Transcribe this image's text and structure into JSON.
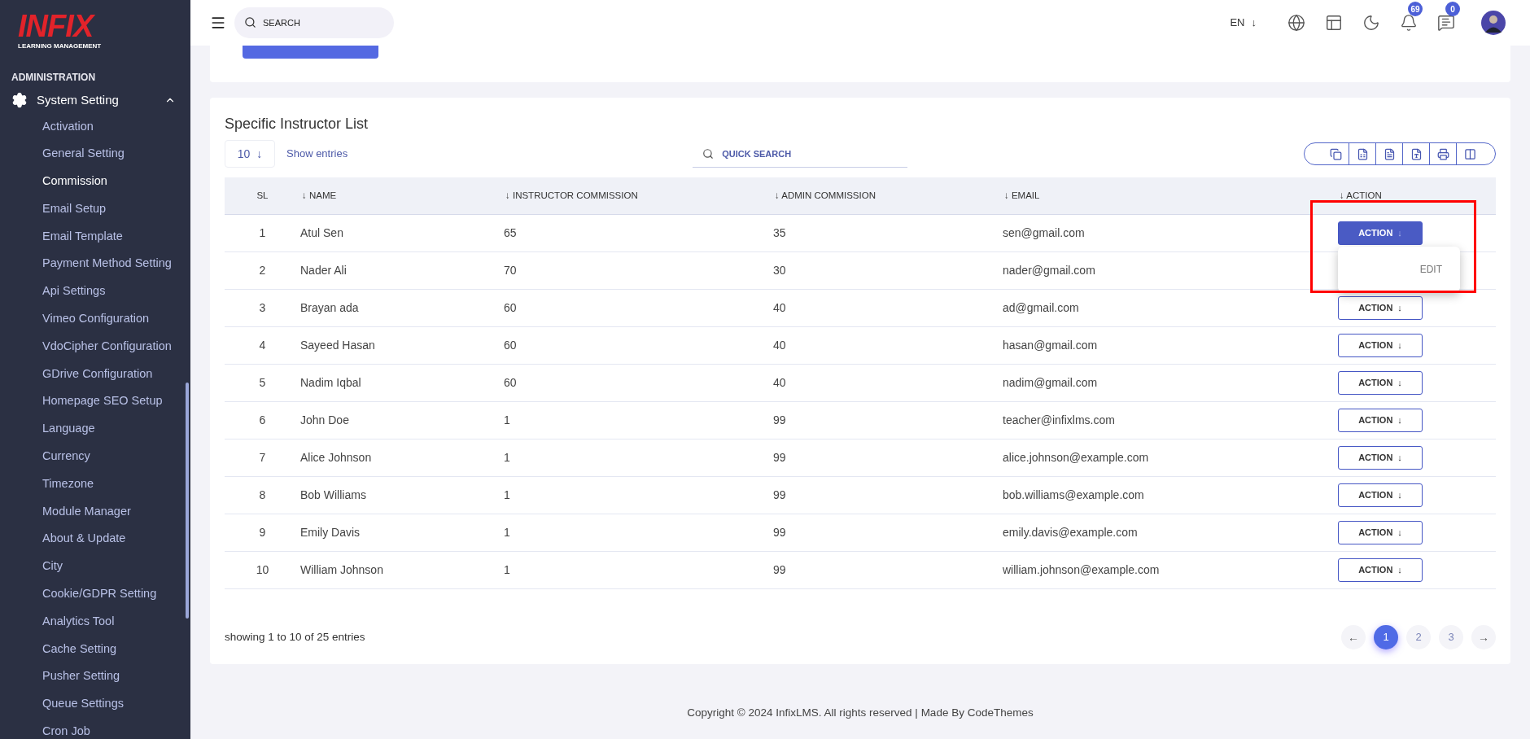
{
  "sidebar": {
    "logo": {
      "title": "INFIX",
      "subtitle": "LEARNING MANAGEMENT"
    },
    "section": "ADMINISTRATION",
    "group": {
      "label": "System Setting",
      "expanded": true
    },
    "items": [
      {
        "label": "Activation",
        "selected": false
      },
      {
        "label": "General Setting",
        "selected": false
      },
      {
        "label": "Commission",
        "selected": true
      },
      {
        "label": "Email Setup",
        "selected": false
      },
      {
        "label": "Email Template",
        "selected": false
      },
      {
        "label": "Payment Method Setting",
        "selected": false
      },
      {
        "label": "Api Settings",
        "selected": false
      },
      {
        "label": "Vimeo Configuration",
        "selected": false
      },
      {
        "label": "VdoCipher Configuration",
        "selected": false
      },
      {
        "label": "GDrive Configuration",
        "selected": false
      },
      {
        "label": "Homepage SEO Setup",
        "selected": false
      },
      {
        "label": "Language",
        "selected": false
      },
      {
        "label": "Currency",
        "selected": false
      },
      {
        "label": "Timezone",
        "selected": false
      },
      {
        "label": "Module Manager",
        "selected": false
      },
      {
        "label": "About & Update",
        "selected": false
      },
      {
        "label": "City",
        "selected": false
      },
      {
        "label": "Cookie/GDPR Setting",
        "selected": false
      },
      {
        "label": "Analytics Tool",
        "selected": false
      },
      {
        "label": "Cache Setting",
        "selected": false
      },
      {
        "label": "Pusher Setting",
        "selected": false
      },
      {
        "label": "Queue Settings",
        "selected": false
      },
      {
        "label": "Cron Job",
        "selected": false
      }
    ]
  },
  "header": {
    "search": {
      "placeholder": "SEARCH"
    },
    "language": "EN",
    "language_caret": "↓",
    "notifications": "69",
    "messages": "0"
  },
  "card": {
    "title": "Specific Instructor List",
    "page_size": "10",
    "page_size_caret": "↓",
    "show_entries": "Show entries",
    "quick_search": {
      "placeholder": "QUICK SEARCH"
    },
    "export_buttons": [
      {
        "kind": "copy"
      },
      {
        "kind": "excel"
      },
      {
        "kind": "csv"
      },
      {
        "kind": "pdf"
      },
      {
        "kind": "print"
      },
      {
        "kind": "columns"
      }
    ],
    "columns": [
      {
        "label": "SL"
      },
      {
        "label": "NAME",
        "sort": "↓"
      },
      {
        "label": "INSTRUCTOR COMMISSION",
        "sort": "↓"
      },
      {
        "label": "ADMIN COMMISSION",
        "sort": "↓"
      },
      {
        "label": "EMAIL",
        "sort": "↓"
      },
      {
        "label": "ACTION",
        "sort": "↓"
      }
    ],
    "rows": [
      {
        "sl": "1",
        "name": "Atul Sen",
        "instructor": "65",
        "admin": "35",
        "email": "sen@gmail.com",
        "action": "ACTION",
        "caret": "↓",
        "open": true
      },
      {
        "sl": "2",
        "name": "Nader Ali",
        "instructor": "70",
        "admin": "30",
        "email": "nader@gmail.com"
      },
      {
        "sl": "3",
        "name": "Brayan ada",
        "instructor": "60",
        "admin": "40",
        "email": "ad@gmail.com",
        "action": "ACTION",
        "caret": "↓",
        "open": false
      },
      {
        "sl": "4",
        "name": "Sayeed Hasan",
        "instructor": "60",
        "admin": "40",
        "email": "hasan@gmail.com",
        "action": "ACTION",
        "caret": "↓",
        "open": false
      },
      {
        "sl": "5",
        "name": "Nadim Iqbal",
        "instructor": "60",
        "admin": "40",
        "email": "nadim@gmail.com",
        "action": "ACTION",
        "caret": "↓",
        "open": false
      },
      {
        "sl": "6",
        "name": "John Doe",
        "instructor": "1",
        "admin": "99",
        "email": "teacher@infixlms.com",
        "action": "ACTION",
        "caret": "↓",
        "open": false
      },
      {
        "sl": "7",
        "name": "Alice Johnson",
        "instructor": "1",
        "admin": "99",
        "email": "alice.johnson@example.com",
        "action": "ACTION",
        "caret": "↓",
        "open": false
      },
      {
        "sl": "8",
        "name": "Bob Williams",
        "instructor": "1",
        "admin": "99",
        "email": "bob.williams@example.com",
        "action": "ACTION",
        "caret": "↓",
        "open": false
      },
      {
        "sl": "9",
        "name": "Emily Davis",
        "instructor": "1",
        "admin": "99",
        "email": "emily.davis@example.com",
        "action": "ACTION",
        "caret": "↓",
        "open": false
      },
      {
        "sl": "10",
        "name": "William Johnson",
        "instructor": "1",
        "admin": "99",
        "email": "william.johnson@example.com",
        "action": "ACTION",
        "caret": "↓",
        "open": false
      }
    ],
    "dropdown": {
      "items": [
        "EDIT"
      ]
    },
    "summary": "showing 1 to 10 of 25 entries",
    "pagination": {
      "prev": "←",
      "next": "→",
      "pages": [
        {
          "label": "1",
          "selected": true
        },
        {
          "label": "2",
          "selected": false
        },
        {
          "label": "3",
          "selected": false
        }
      ]
    }
  },
  "footer": "Copyright © 2024 InfixLMS. All rights reserved | Made By CodeThemes"
}
